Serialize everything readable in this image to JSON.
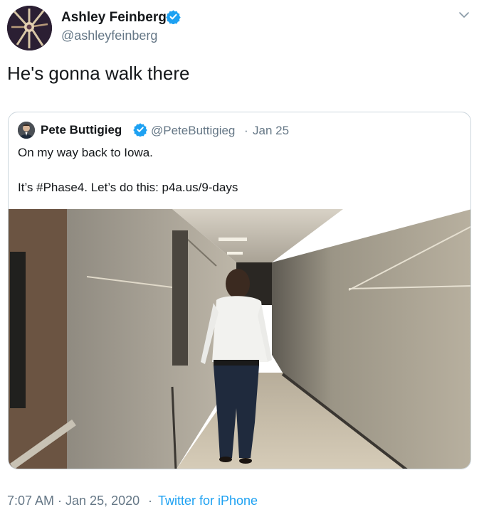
{
  "tweet": {
    "author": {
      "name": "Ashley Feinberg",
      "handle": "@ashleyfeinberg",
      "avatar_icon": "profile-avatar"
    },
    "text": "He's gonna walk there",
    "quoted": {
      "name": "Pete Buttigieg",
      "handle": "@PeteButtigieg",
      "separator": "·",
      "date": "Jan 25",
      "line1": "On my way back to Iowa.",
      "line2": "It’s #Phase4. Let’s do this: p4a.us/9-days",
      "photo_subject": "man walking down a school hallway"
    },
    "footer": {
      "time": "7:07 AM · Jan 25, 2020",
      "separator": "·",
      "source": "Twitter for iPhone"
    }
  },
  "colors": {
    "text": "#14171a",
    "secondary": "#657786",
    "link": "#1da1f2",
    "verified": "#1da1f2",
    "card_border": "#ccd6dd"
  },
  "icons": [
    "verified-badge-icon",
    "chevron-down-icon"
  ]
}
